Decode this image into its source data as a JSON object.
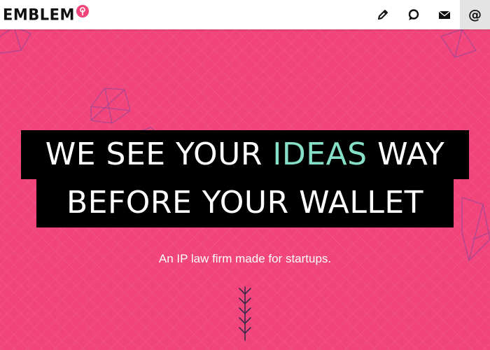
{
  "brand": {
    "name": "EMBLEM",
    "mark_color": "#f0447a"
  },
  "nav": {
    "items": [
      {
        "icon": "pencil-icon"
      },
      {
        "icon": "chat-bubble-icon"
      },
      {
        "icon": "envelope-icon"
      },
      {
        "icon": "at-sign-icon",
        "glyph": "@"
      }
    ]
  },
  "hero": {
    "line1_part1": "WE SEE YOUR ",
    "line1_accent": "IDEAS",
    "line1_part2": " WAY",
    "line2": "BEFORE YOUR WALLET",
    "subtitle": "An IP law firm made for startups."
  },
  "colors": {
    "background": "#f0447a",
    "accent": "#86e0c8",
    "headline_bg": "#000000",
    "text": "#ffffff"
  }
}
